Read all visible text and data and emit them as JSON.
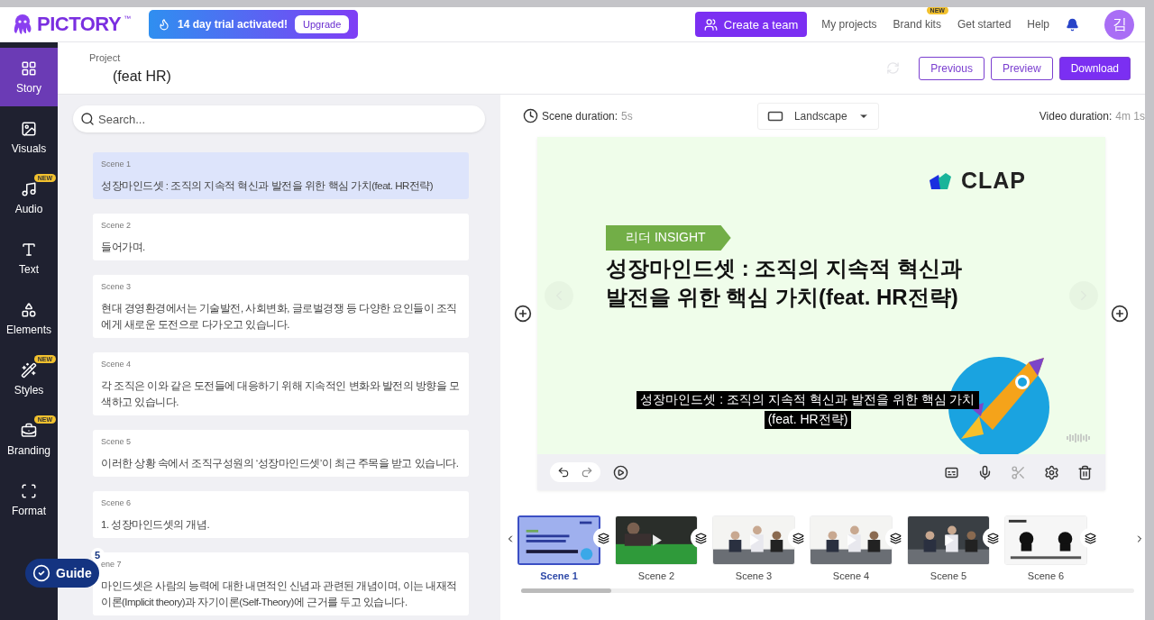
{
  "header": {
    "logo": "PICTORY",
    "trademark": "™",
    "trial": {
      "text": "14 day trial activated!",
      "button": "Upgrade"
    },
    "create_team": "Create a team",
    "links": [
      {
        "label": "My projects"
      },
      {
        "label": "Brand kits",
        "badge": "NEW"
      },
      {
        "label": "Get started"
      },
      {
        "label": "Help"
      }
    ],
    "avatar": "김"
  },
  "sidebar": {
    "items": [
      {
        "label": "Story",
        "selected": true
      },
      {
        "label": "Visuals",
        "selected": false
      },
      {
        "label": "Audio",
        "selected": false,
        "badge": "NEW"
      },
      {
        "label": "Text",
        "selected": false
      },
      {
        "label": "Elements",
        "selected": false
      },
      {
        "label": "Styles",
        "selected": false,
        "badge": "NEW"
      },
      {
        "label": "Branding",
        "selected": false,
        "badge": "NEW"
      },
      {
        "label": "Format",
        "selected": false
      }
    ]
  },
  "project": {
    "label": "Project",
    "title": "(feat HR)",
    "buttons": [
      {
        "label": "Previous",
        "kind": "outline"
      },
      {
        "label": "Preview",
        "kind": "outline"
      },
      {
        "label": "Download",
        "kind": "primary"
      }
    ]
  },
  "search": {
    "placeholder": "Search..."
  },
  "scenes": [
    {
      "label": "Scene 1",
      "text": "성장마인드셋 : 조직의 지속적 혁신과 발전을 위한 핵심 가치(feat. HR전략)",
      "selected": true
    },
    {
      "label": "Scene 2",
      "text": "들어가며.",
      "selected": false
    },
    {
      "label": "Scene 3",
      "text": "현대 경영환경에서는 기술발전, 사회변화, 글로벌경쟁 등 다양한 요인들이 조직에게 새로운 도전으로 다가오고 있습니다.",
      "selected": false
    },
    {
      "label": "Scene 4",
      "text": "각 조직은 이와 같은 도전들에 대응하기 위해 지속적인 변화와 발전의 방향을 모색하고 있습니다.",
      "selected": false
    },
    {
      "label": "Scene 5",
      "text": "이러한 상황 속에서 조직구성원의 ‘성장마인드셋’이 최근 주목을 받고 있습니다.",
      "selected": false
    },
    {
      "label": "Scene 6",
      "text": "1. 성장마인드셋의 개념.",
      "selected": false
    },
    {
      "label": "ene 7",
      "text": "마인드셋은 사람의 능력에 대한 내면적인 신념과 관련된 개념이며, 이는 내재적 이론(Implicit theory)과 자기이론(Self-Theory)에 근거를 두고 있습니다.",
      "selected": false
    }
  ],
  "guide": {
    "label": "Guide",
    "count": "5"
  },
  "editor": {
    "scene_duration": {
      "label": "Scene duration:",
      "value": "5s"
    },
    "orientation": "Landscape",
    "video_duration": {
      "label": "Video duration:",
      "value": "4m 1s"
    }
  },
  "slide": {
    "brand": "CLAP",
    "tag": "리더 INSIGHT",
    "title_lines": [
      "성장마인드셋 : 조직의 지속적 혁신과",
      "발전을 위한 핵심 가치(feat. HR전략)"
    ],
    "caption_lines": [
      "성장마인드셋 : 조직의 지속적 혁신과 발전을 위한 핵심 가치",
      "(feat. HR전략)"
    ]
  },
  "timeline": [
    {
      "label": "Scene 1",
      "selected": true,
      "kind": "slide"
    },
    {
      "label": "Scene 2",
      "selected": false,
      "kind": "video"
    },
    {
      "label": "Scene 3",
      "selected": false,
      "kind": "video"
    },
    {
      "label": "Scene 4",
      "selected": false,
      "kind": "video"
    },
    {
      "label": "Scene 5",
      "selected": false,
      "kind": "video"
    },
    {
      "label": "Scene 6",
      "selected": false,
      "kind": "slide"
    }
  ]
}
